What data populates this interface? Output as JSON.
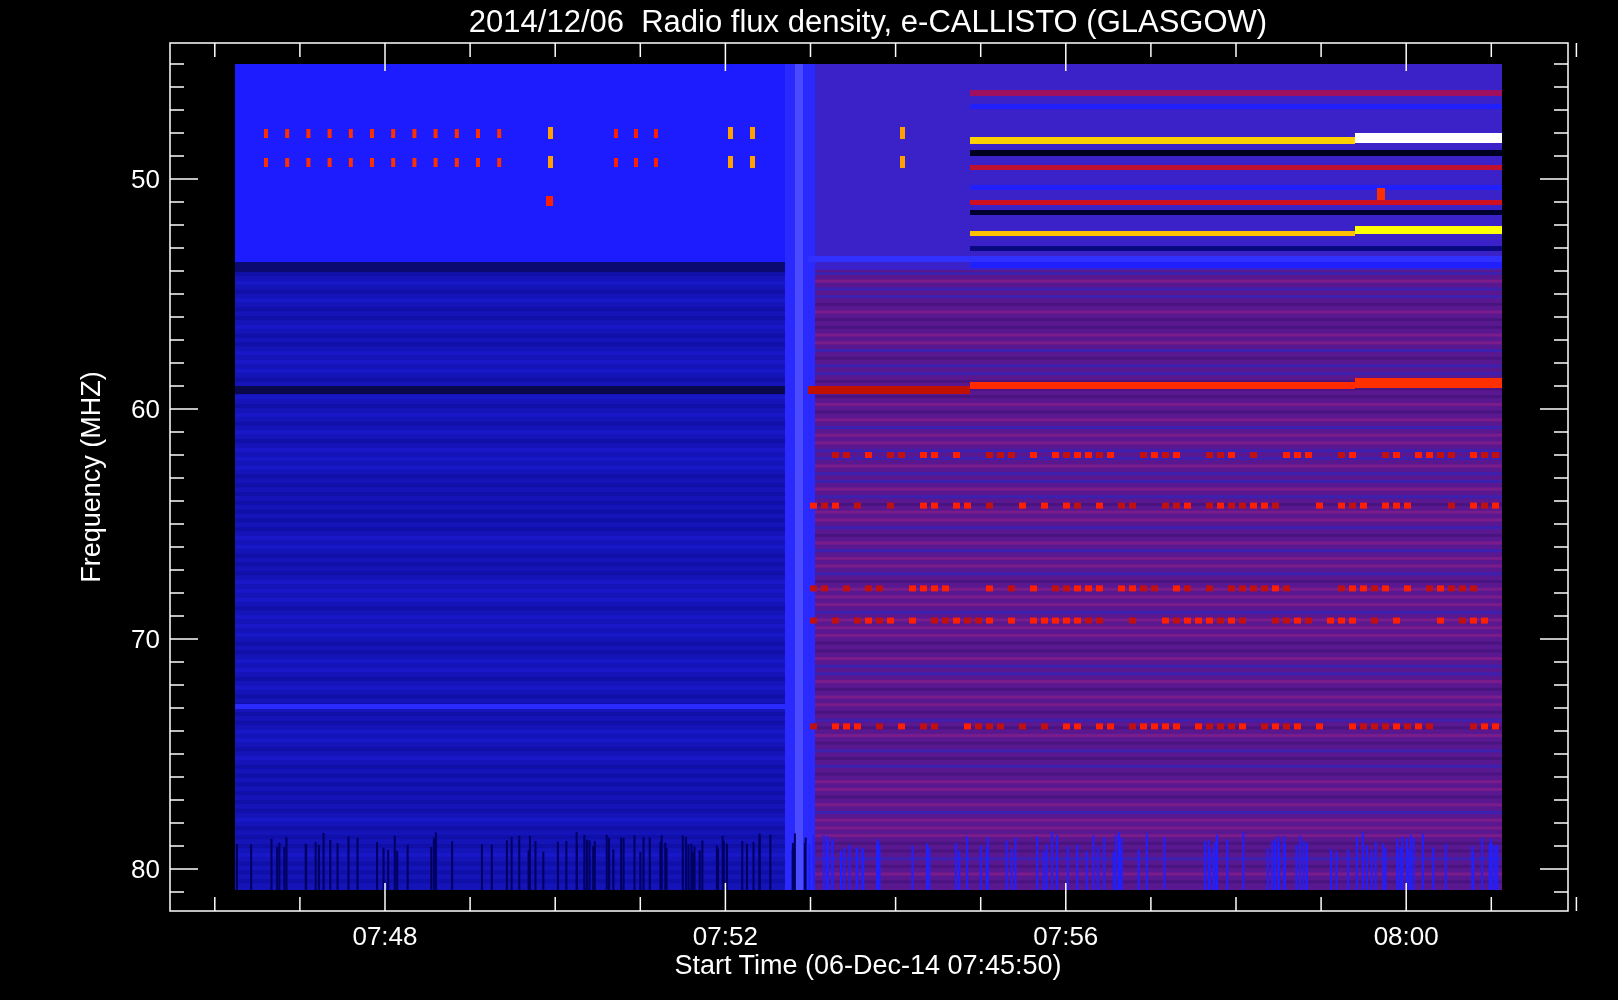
{
  "title": "2014/12/06  Radio flux density, e-CALLISTO (GLASGOW)",
  "ylabel": "Frequency (MHZ)",
  "xlabel": "Start Time (06-Dec-14 07:45:50)",
  "yticks": [
    "50",
    "60",
    "70",
    "80"
  ],
  "xticks": [
    "07:48",
    "07:52",
    "07:56",
    "08:00"
  ]
}
